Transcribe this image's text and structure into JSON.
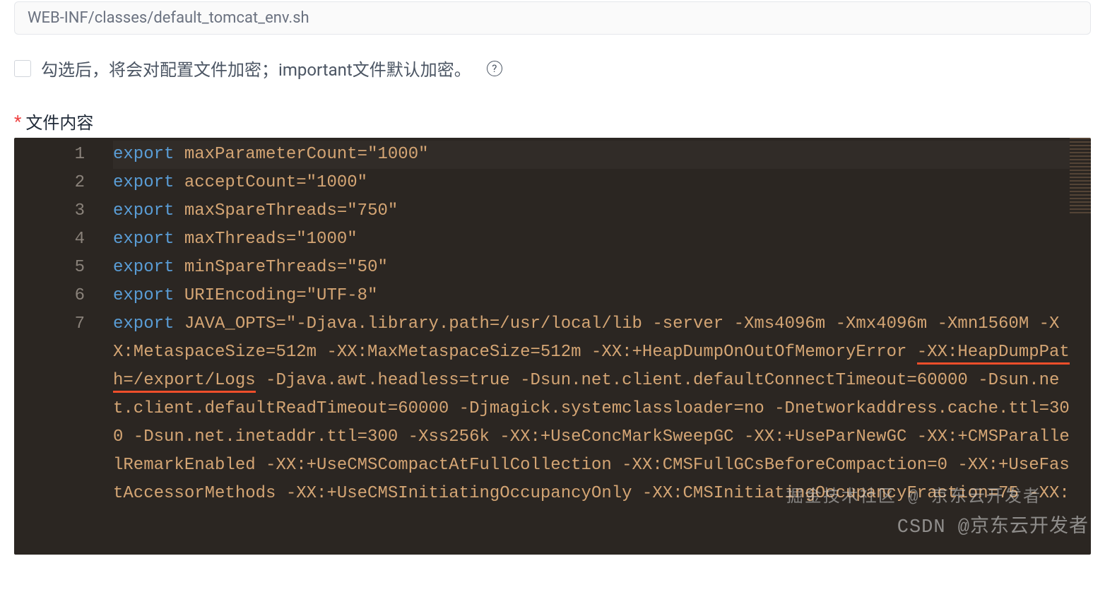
{
  "path_input": {
    "value": "WEB-INF/classes/default_tomcat_env.sh"
  },
  "encrypt_checkbox": {
    "checked": false,
    "label": "勾选后，将会对配置文件加密；important文件默认加密。"
  },
  "content_label": {
    "required": "*",
    "text": "文件内容"
  },
  "editor": {
    "lines": [
      "1",
      "2",
      "3",
      "4",
      "5",
      "6",
      "7"
    ],
    "code": [
      {
        "kw": "export",
        "rest": " maxParameterCount=",
        "val": "\"1000\""
      },
      {
        "kw": "export",
        "rest": " acceptCount=",
        "val": "\"1000\""
      },
      {
        "kw": "export",
        "rest": " maxSpareThreads=",
        "val": "\"750\""
      },
      {
        "kw": "export",
        "rest": " maxThreads=",
        "val": "\"1000\""
      },
      {
        "kw": "export",
        "rest": " minSpareThreads=",
        "val": "\"50\""
      },
      {
        "kw": "export",
        "rest": " URIEncoding=",
        "val": "\"UTF-8\""
      }
    ],
    "line7": {
      "kw": "export",
      "pre": " JAVA_OPTS=",
      "val_before": "\"-Djava.library.path=/usr/local/lib -server -Xms4096m -Xmx4096m -Xmn1560M -XX:MetaspaceSize=512m -XX:MaxMetaspaceSize=512m -XX:+HeapDumpOnOutOfMemoryError ",
      "underlined": "-XX:HeapDumpPath=/export/Logs",
      "val_after": " -Djava.awt.headless=true -Dsun.net.client.defaultConnectTimeout=60000 -Dsun.net.client.defaultReadTimeout=60000 -Djmagick.systemclassloader=no -Dnetworkaddress.cache.ttl=300 -Dsun.net.inetaddr.ttl=300 -Xss256k -XX:+UseConcMarkSweepGC -XX:+UseParNewGC -XX:+CMSParallelRemarkEnabled -XX:+UseCMSCompactAtFullCollection -XX:CMSFullGCsBeforeCompaction=0 -XX:+UseFastAccessorMethods -XX:+UseCMSInitiatingOccupancyOnly -XX:CMSInitiatingOccupancyFraction=75 -XX:"
    }
  },
  "watermarks": {
    "w1": "掘金技术社区 @  京东云开发者",
    "w2": "CSDN @京东云开发者"
  }
}
